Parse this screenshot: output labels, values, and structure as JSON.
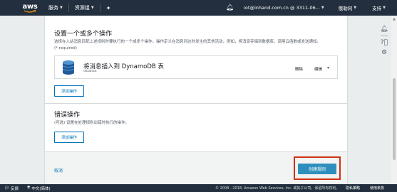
{
  "topnav": {
    "logo": "aws",
    "services_label": "服务",
    "resource_groups_label": "资源组",
    "pin_icon": "pin-icon",
    "user_label": "iot@inhand.com.cn @ 3311-06...",
    "region_label": "俄勒冈",
    "support_label": "支持"
  },
  "section_actions": {
    "title": "设置一个或多个操作",
    "description": "选择在入站消息匹配上述规则时要执行的一个或多个操作。操作定义在消息到达时发生的其他活动，例如，将消息存储到数据库、调用云函数或发送通知。(*.required)",
    "action": {
      "title": "将消息插入到 DynamoDB 表",
      "subtitle": "dataloot",
      "delete_label": "删除",
      "edit_label": "编辑"
    },
    "add_button": "添加操作"
  },
  "section_error": {
    "title": "错误操作",
    "description": "(可选) 设置在处理规则出错时执行的操作。",
    "add_button": "添加操作"
  },
  "footer": {
    "cancel_label": "取消",
    "create_label": "创建规则"
  },
  "bottombar": {
    "feedback_label": "反馈",
    "language_label": "中文(简体)",
    "copyright": "© 2008 - 2018, Amazon Web Services, Inc. 或其子公司。保留所有权利。",
    "privacy_label": "隐私策略",
    "terms_label": "使用条款"
  },
  "colors": {
    "nav_bg": "#232f3e",
    "link": "#0073bb",
    "primary_button": "#2e8fbd",
    "highlight": "#d13212"
  }
}
